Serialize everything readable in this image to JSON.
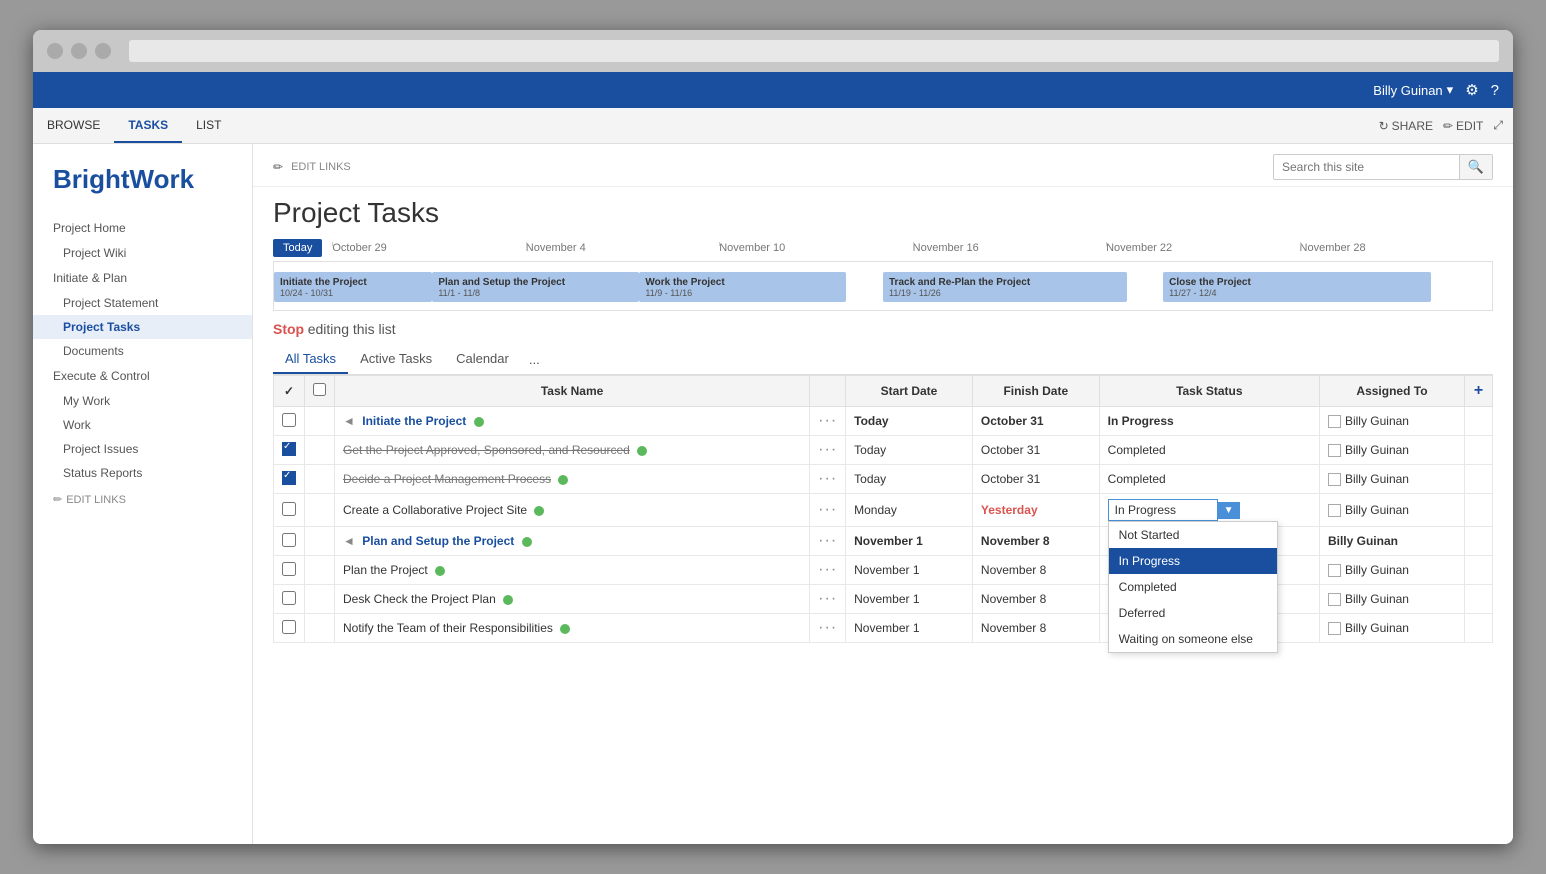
{
  "browser": {
    "dots": [
      "dot1",
      "dot2",
      "dot3"
    ]
  },
  "app_header": {
    "user": "Billy Guinan",
    "gear_icon": "⚙",
    "help_icon": "?"
  },
  "ribbon": {
    "tabs": [
      "BROWSE",
      "TASKS",
      "LIST"
    ],
    "active_tab": "TASKS",
    "actions": [
      {
        "label": "SHARE",
        "icon": "↻"
      },
      {
        "label": "EDIT",
        "icon": "✏"
      },
      {
        "label": "focus",
        "icon": "⤢"
      }
    ]
  },
  "breadcrumb": {
    "edit_links": "EDIT LINKS"
  },
  "search": {
    "placeholder": "Search this site"
  },
  "sidebar": {
    "logo_part1": "Bright",
    "logo_part2": "Work",
    "items": [
      {
        "label": "Project Home",
        "level": 1,
        "id": "project-home"
      },
      {
        "label": "Project Wiki",
        "level": 2,
        "id": "project-wiki"
      },
      {
        "label": "Initiate & Plan",
        "level": 1,
        "id": "initiate-plan"
      },
      {
        "label": "Project Statement",
        "level": 2,
        "id": "project-statement"
      },
      {
        "label": "Project Tasks",
        "level": 2,
        "id": "project-tasks",
        "active": true
      },
      {
        "label": "Documents",
        "level": 2,
        "id": "documents"
      },
      {
        "label": "Execute & Control",
        "level": 1,
        "id": "execute-control"
      },
      {
        "label": "My Work",
        "level": 2,
        "id": "my-work"
      },
      {
        "label": "Work",
        "level": 2,
        "id": "work"
      },
      {
        "label": "Project Issues",
        "level": 2,
        "id": "project-issues"
      },
      {
        "label": "Status Reports",
        "level": 2,
        "id": "status-reports"
      }
    ],
    "edit_links": "EDIT LINKS"
  },
  "page": {
    "title": "Project Tasks",
    "edit_links": "EDIT LINKS"
  },
  "gantt": {
    "today_btn": "Today",
    "dates": [
      "October 29",
      "November 4",
      "November 10",
      "November 16",
      "November 22",
      "November 28"
    ],
    "bars": [
      {
        "title": "Initiate the Project",
        "dates": "10/24 - 10/31",
        "left_pct": 0,
        "width_pct": 13,
        "color": "#a8c4e8"
      },
      {
        "title": "Plan and Setup the Project",
        "dates": "11/1 - 11/8",
        "left_pct": 13,
        "width_pct": 17,
        "color": "#a8c4e8"
      },
      {
        "title": "Work the Project",
        "dates": "11/9 - 11/16",
        "left_pct": 30,
        "width_pct": 17,
        "color": "#a8c4e8"
      },
      {
        "title": "Track and Re-Plan the Project",
        "dates": "11/19 - 11/26",
        "left_pct": 50,
        "width_pct": 20,
        "color": "#a8c4e8"
      },
      {
        "title": "Close the Project",
        "dates": "11/27 - 12/4",
        "left_pct": 73,
        "width_pct": 22,
        "color": "#a8c4e8"
      }
    ]
  },
  "stop_editing": {
    "stop_label": "Stop",
    "rest_label": " editing this list"
  },
  "view_tabs": {
    "tabs": [
      "All Tasks",
      "Active Tasks",
      "Calendar"
    ],
    "active": "All Tasks",
    "more": "..."
  },
  "table": {
    "headers": [
      "",
      "",
      "Task Name",
      "",
      "Start Date",
      "Finish Date",
      "Task Status",
      "Assigned To",
      ""
    ],
    "add_btn": "+",
    "rows": [
      {
        "id": "row1",
        "checkbox": false,
        "expand": "◄",
        "name": "Initiate the Project",
        "tag": true,
        "dots": "...",
        "start": "Today",
        "finish": "October 31",
        "finish_bold": true,
        "status": "In Progress",
        "status_bold": true,
        "assigned": "Billy Guinan",
        "bold_row": true,
        "strikethrough": false
      },
      {
        "id": "row2",
        "checkbox": true,
        "expand": "",
        "name": "Get the Project Approved, Sponsored, and Resourced",
        "tag": true,
        "dots": "...",
        "start": "Today",
        "finish": "October 31",
        "finish_bold": false,
        "status": "Completed",
        "status_bold": false,
        "assigned": "Billy Guinan",
        "bold_row": false,
        "strikethrough": true
      },
      {
        "id": "row3",
        "checkbox": true,
        "expand": "",
        "name": "Decide a Project Management Process",
        "tag": true,
        "dots": "...",
        "start": "Today",
        "finish": "October 31",
        "finish_bold": false,
        "status": "Completed",
        "status_bold": false,
        "assigned": "Billy Guinan",
        "bold_row": false,
        "strikethrough": true
      },
      {
        "id": "row4",
        "checkbox": false,
        "expand": "",
        "name": "Create a Collaborative Project Site",
        "tag": true,
        "dots": "...",
        "start": "Monday",
        "finish": "Yesterday",
        "finish_bold": false,
        "finish_overdue": true,
        "status": "In Progress",
        "status_bold": false,
        "status_dropdown": true,
        "assigned": "Billy Guinan",
        "bold_row": false,
        "strikethrough": false
      },
      {
        "id": "row5",
        "checkbox": false,
        "expand": "◄",
        "name": "Plan and Setup the Project",
        "tag": true,
        "dots": "...",
        "start": "November 1",
        "finish": "November 8",
        "finish_bold": true,
        "status": "Billy Guinan",
        "status_bold": true,
        "assigned": "Billy Guinan",
        "bold_row": true,
        "strikethrough": false,
        "is_plan_row": true
      },
      {
        "id": "row6",
        "checkbox": false,
        "expand": "",
        "name": "Plan the Project",
        "tag": true,
        "dots": "...",
        "start": "November 1",
        "finish": "November 8",
        "finish_bold": false,
        "status": "Not Started",
        "status_bold": false,
        "assigned": "Billy Guinan",
        "bold_row": false,
        "strikethrough": false
      },
      {
        "id": "row7",
        "checkbox": false,
        "expand": "",
        "name": "Desk Check the Project Plan",
        "tag": true,
        "dots": "...",
        "start": "November 1",
        "finish": "November 8",
        "finish_bold": false,
        "status": "Not Started",
        "status_bold": false,
        "assigned": "Billy Guinan",
        "bold_row": false,
        "strikethrough": false
      },
      {
        "id": "row8",
        "checkbox": false,
        "expand": "",
        "name": "Notify the Team of their Responsibilities",
        "tag": true,
        "dots": "...",
        "start": "November 1",
        "finish": "November 8",
        "finish_bold": false,
        "status": "Not Started",
        "status_bold": false,
        "assigned": "Billy Guinan",
        "bold_row": false,
        "strikethrough": false
      }
    ],
    "dropdown_options": [
      {
        "label": "Not Started",
        "selected": false
      },
      {
        "label": "In Progress",
        "selected": true
      },
      {
        "label": "Completed",
        "selected": false
      },
      {
        "label": "Deferred",
        "selected": false
      },
      {
        "label": "Waiting on someone else",
        "selected": false
      }
    ]
  }
}
